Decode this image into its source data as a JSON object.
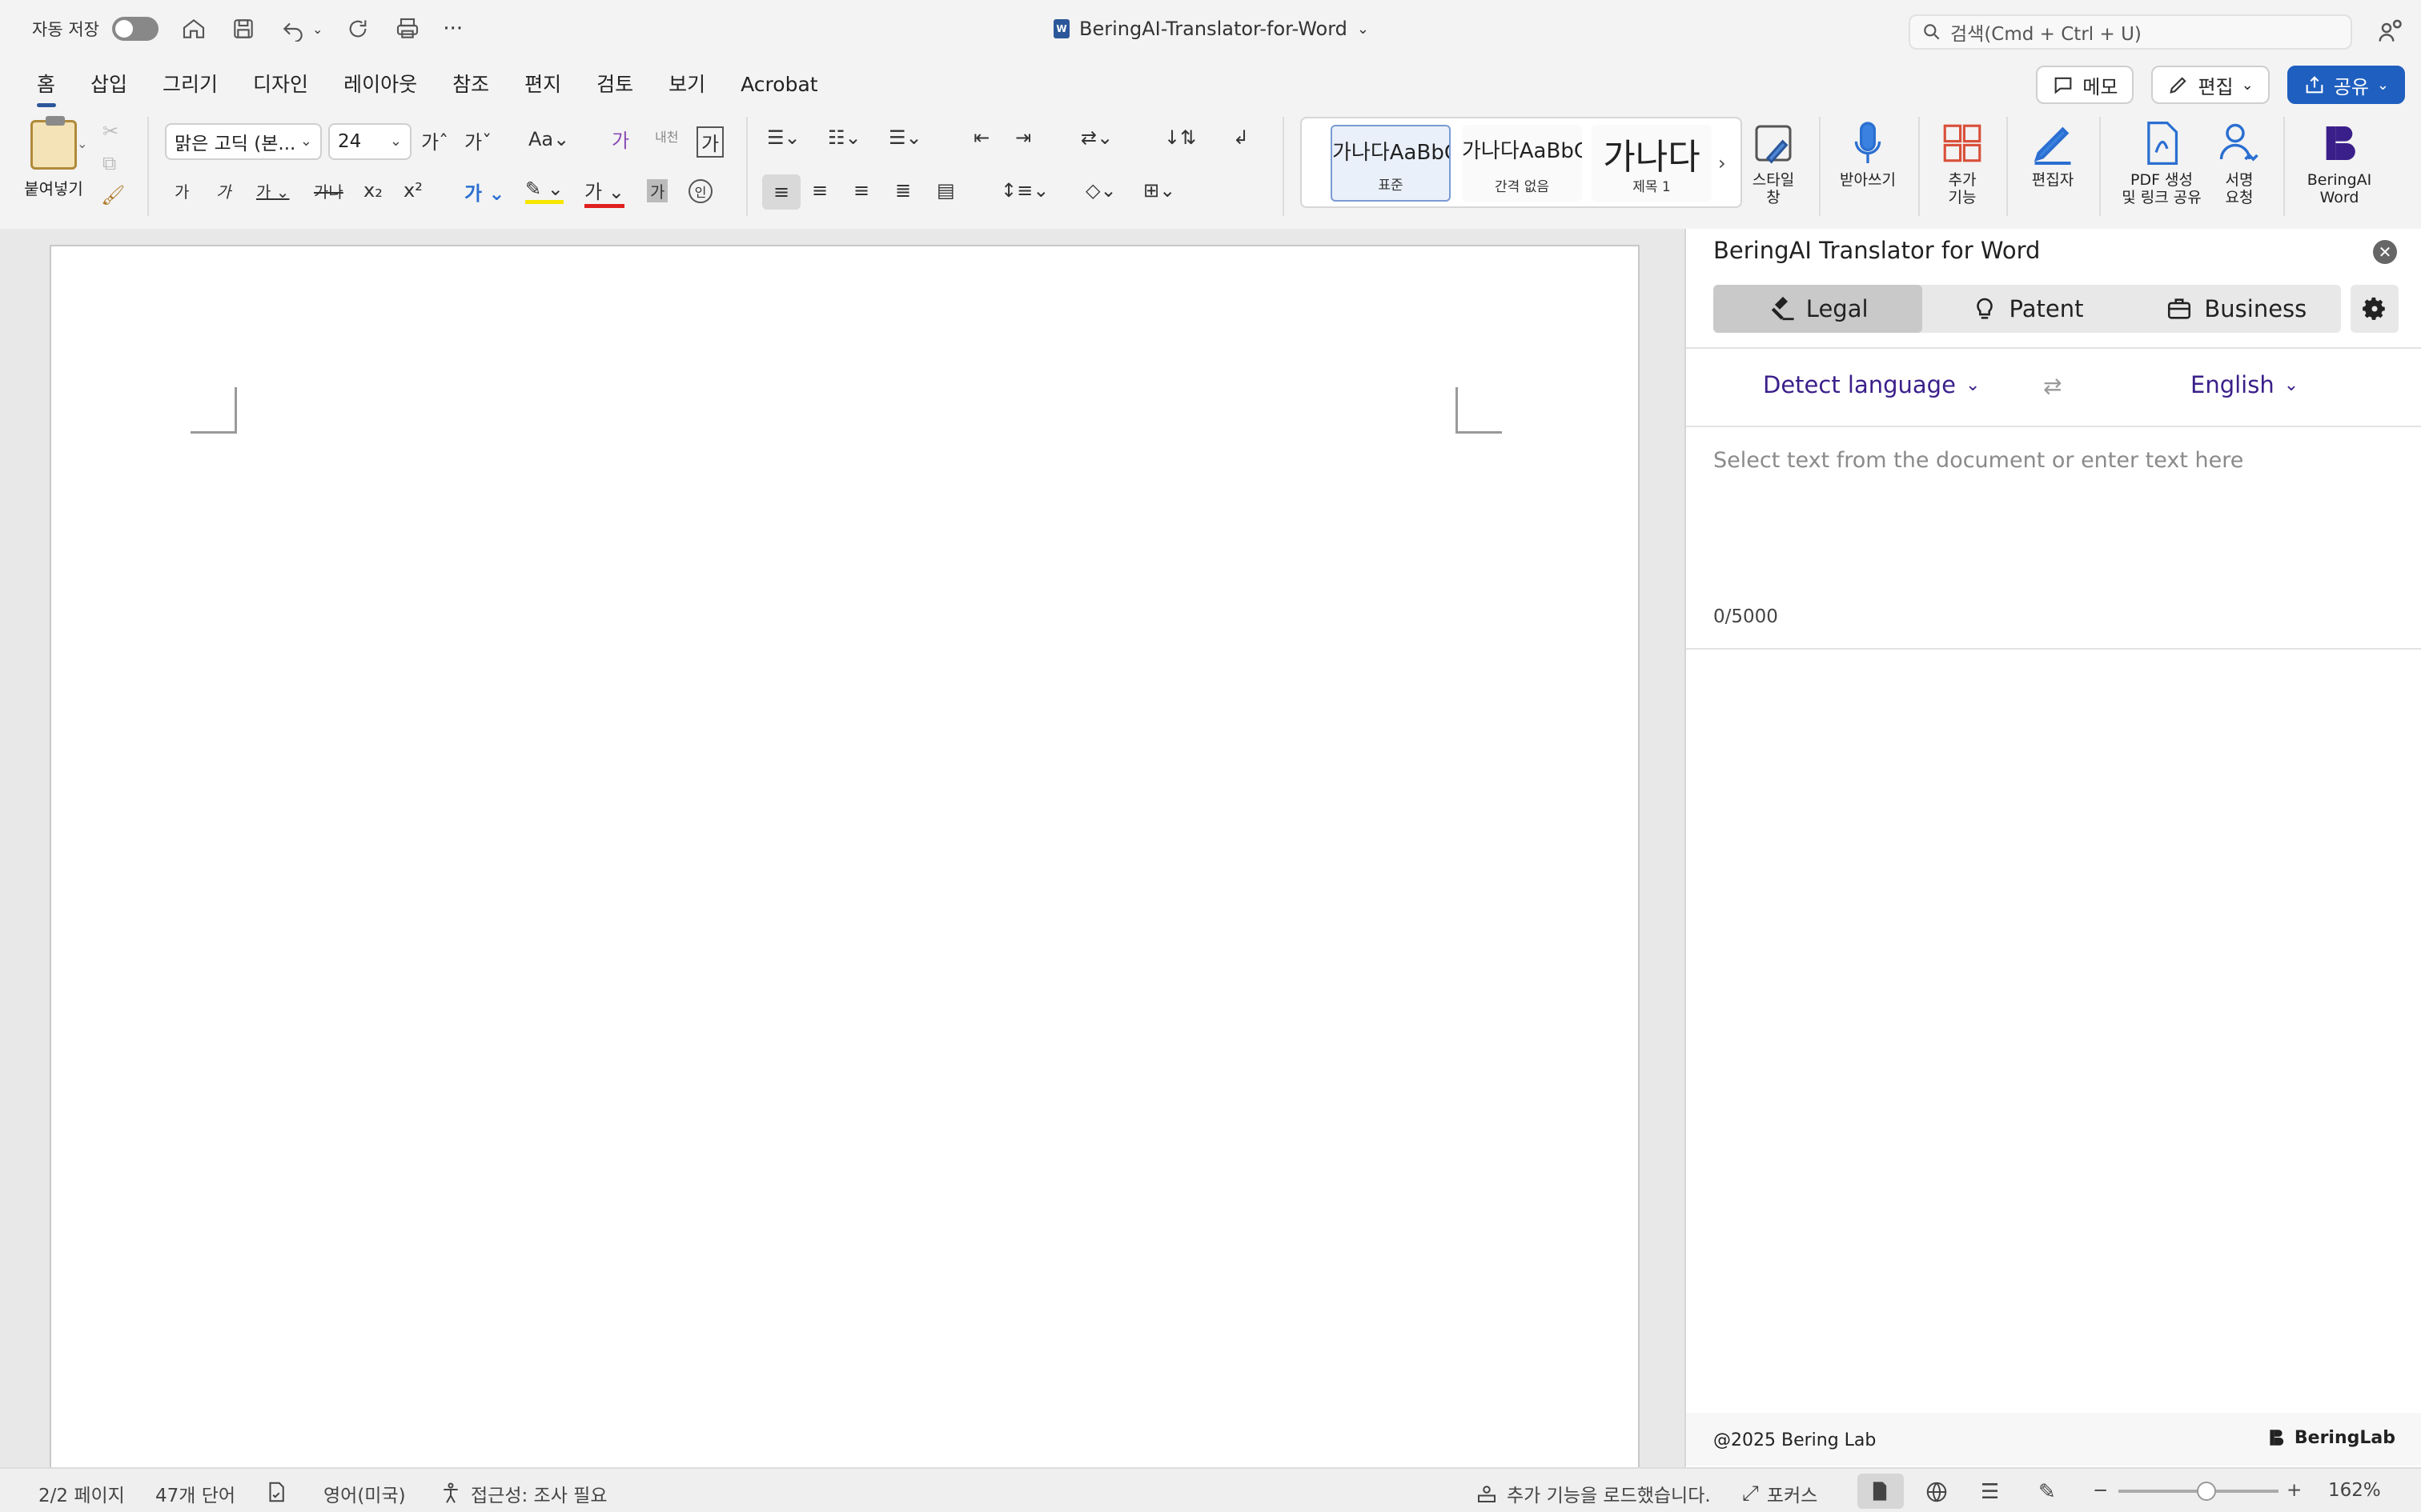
{
  "titlebar": {
    "autosave_label": "자동 저장",
    "doc_title": "BeringAI-Translator-for-Word",
    "search_placeholder": "검색(Cmd + Ctrl + U)"
  },
  "tabs": [
    "홈",
    "삽입",
    "그리기",
    "디자인",
    "레이아웃",
    "참조",
    "편지",
    "검토",
    "보기",
    "Acrobat"
  ],
  "ribbon_actions": {
    "memo": "메모",
    "edit": "편집",
    "share": "공유"
  },
  "ribbon": {
    "paste_label": "붙여넣기",
    "font_name": "맑은 고딕 (본...",
    "font_size": "24",
    "styles": [
      {
        "preview": "가나다AaBbC",
        "caption": "표준"
      },
      {
        "preview": "가나다AaBbC",
        "caption": "간격 없음"
      },
      {
        "preview": "가나다",
        "caption": "제목 1"
      }
    ],
    "style_pane": "스타일\n창",
    "dictate": "받아쓰기",
    "addins": "추가\n기능",
    "editor": "편집자",
    "pdf": "PDF 생성\n및 링크 공유",
    "sign": "서명\n요청",
    "beringai": "BeringAI\nWord"
  },
  "pane": {
    "title": "BeringAI Translator for Word",
    "modes": [
      {
        "label": "Legal",
        "icon": "gavel-icon"
      },
      {
        "label": "Patent",
        "icon": "lightbulb-icon"
      },
      {
        "label": "Business",
        "icon": "briefcase-icon"
      }
    ],
    "source_lang": "Detect language",
    "target_lang": "English",
    "placeholder": "Select text from the document or enter text here",
    "counter": "0/5000",
    "footer_copyright": "@2025 Bering Lab",
    "footer_brand": "BeringLab"
  },
  "status": {
    "pages": "2/2 페이지",
    "words": "47개 단어",
    "language": "영어(미국)",
    "accessibility": "접근성: 조사 필요",
    "addins_loaded": "추가 기능을 로드했습니다.",
    "focus": "포커스",
    "zoom": "162%"
  },
  "colors": {
    "accent": "#2b579a",
    "share": "#1f5fbf",
    "lang": "#3a1f8a"
  }
}
